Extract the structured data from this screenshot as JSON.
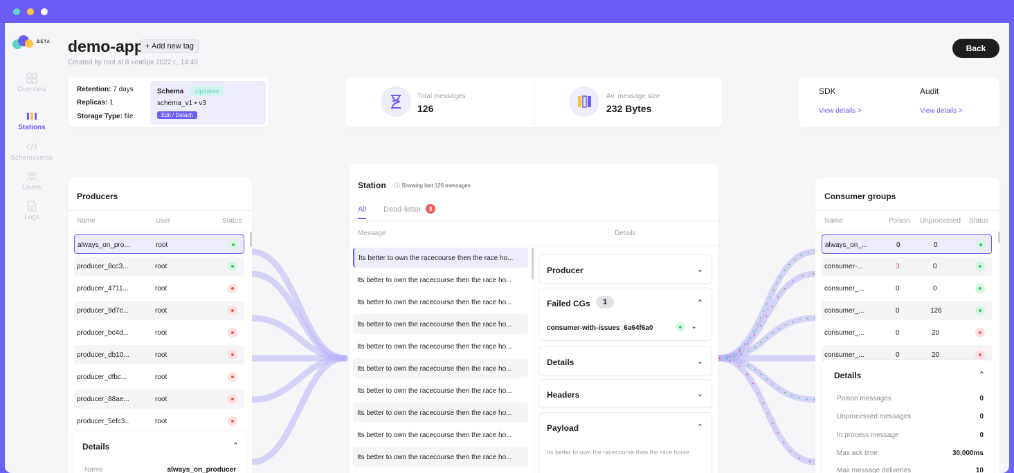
{
  "sidebar": {
    "beta": "BETA",
    "items": [
      {
        "label": "Overview"
      },
      {
        "label": "Stations"
      },
      {
        "label": "Schemaverse"
      },
      {
        "label": "Users"
      },
      {
        "label": "Logs"
      }
    ]
  },
  "header": {
    "title": "demo-app",
    "add_tag": "+ Add new tag",
    "created": "Created by root at 8 ноября 2022 г., 14:40",
    "back": "Back"
  },
  "info": {
    "retention_label": "Retention:",
    "retention_value": "7 days",
    "replicas_label": "Replicas:",
    "replicas_value": "1",
    "storage_label": "Storage Type:",
    "storage_value": "file",
    "schema_title": "Schema",
    "schema_badge": "Updated",
    "schema_version": "schema_v1 • v3",
    "schema_edit": "Edit / Detach"
  },
  "stats": {
    "total_label": "Total messages",
    "total_value": "126",
    "size_label": "Av. message size",
    "size_value": "232 Bytes"
  },
  "sdk": {
    "sdk_title": "SDK",
    "sdk_link": "View details >",
    "audit_title": "Audit",
    "audit_link": "View details >"
  },
  "producers": {
    "title": "Producers",
    "cols": [
      "Name",
      "User",
      "Status"
    ],
    "rows": [
      {
        "name": "always_on_pro...",
        "user": "root",
        "status": "green"
      },
      {
        "name": "producer_8cc3...",
        "user": "root",
        "status": "green"
      },
      {
        "name": "producer_4711...",
        "user": "root",
        "status": "red"
      },
      {
        "name": "producer_9d7c...",
        "user": "root",
        "status": "red"
      },
      {
        "name": "producer_bc4d...",
        "user": "root",
        "status": "red"
      },
      {
        "name": "producer_db10...",
        "user": "root",
        "status": "red"
      },
      {
        "name": "producer_dfbc...",
        "user": "root",
        "status": "red"
      },
      {
        "name": "producer_88ae...",
        "user": "root",
        "status": "red"
      },
      {
        "name": "producer_5efc3...",
        "user": "root",
        "status": "red"
      }
    ],
    "details_title": "Details",
    "details_key": "Name",
    "details_value": "always_on_producer"
  },
  "station": {
    "title": "Station",
    "subtitle": "ⓘ Showing last 126 messages",
    "tab_all": "All",
    "tab_deadletter": "Dead-letter",
    "deadletter_count": "3",
    "col_message": "Message",
    "col_details": "Details",
    "messages": [
      "Its better to own the racecourse then the race ho...",
      "Its better to own the racecourse then the race ho...",
      "Its better to own the racecourse then the race ho...",
      "Its better to own the racecourse then the race ho...",
      "Its better to own the racecourse then the race ho...",
      "Its better to own the racecourse then the race ho...",
      "Its better to own the racecourse then the race ho...",
      "Its better to own the racecourse then the race ho...",
      "Its better to own the racecourse then the race ho...",
      "Its better to own the racecourse then the race ho..."
    ],
    "acc_producer": "Producer",
    "acc_failed": "Failed CGs",
    "failed_count": "1",
    "failed_cg": "consumer-with-issues_6a64f6a0",
    "acc_details": "Details",
    "acc_headers": "Headers",
    "acc_payload": "Payload",
    "payload_text": "Its better to own the racecourse then the race horse"
  },
  "consumers": {
    "title": "Consumer groups",
    "cols": [
      "Name",
      "Poison",
      "Unprocessed",
      "Status"
    ],
    "rows": [
      {
        "name": "always_on_...",
        "poison": "0",
        "unprocessed": "0",
        "status": "green"
      },
      {
        "name": "consumer-...",
        "poison": "3",
        "unprocessed": "0",
        "status": "green"
      },
      {
        "name": "consumer_...",
        "poison": "0",
        "unprocessed": "0",
        "status": "green"
      },
      {
        "name": "consumer_...",
        "poison": "0",
        "unprocessed": "126",
        "status": "green"
      },
      {
        "name": "consumer_...",
        "poison": "0",
        "unprocessed": "20",
        "status": "red"
      },
      {
        "name": "consumer_...",
        "poison": "0",
        "unprocessed": "20",
        "status": "red"
      }
    ],
    "details_title": "Details",
    "details": [
      {
        "k": "Poison messages",
        "v": "0"
      },
      {
        "k": "Unprocessed messages",
        "v": "0"
      },
      {
        "k": "In process message",
        "v": "0"
      },
      {
        "k": "Max ack time",
        "v": "30,000ms"
      },
      {
        "k": "Max message deliveries",
        "v": "10"
      }
    ]
  },
  "colors": {
    "accent": "#6b5cf5",
    "green": "#2ecc71",
    "red": "#ed5b5b",
    "teal": "#5fd3c9"
  }
}
